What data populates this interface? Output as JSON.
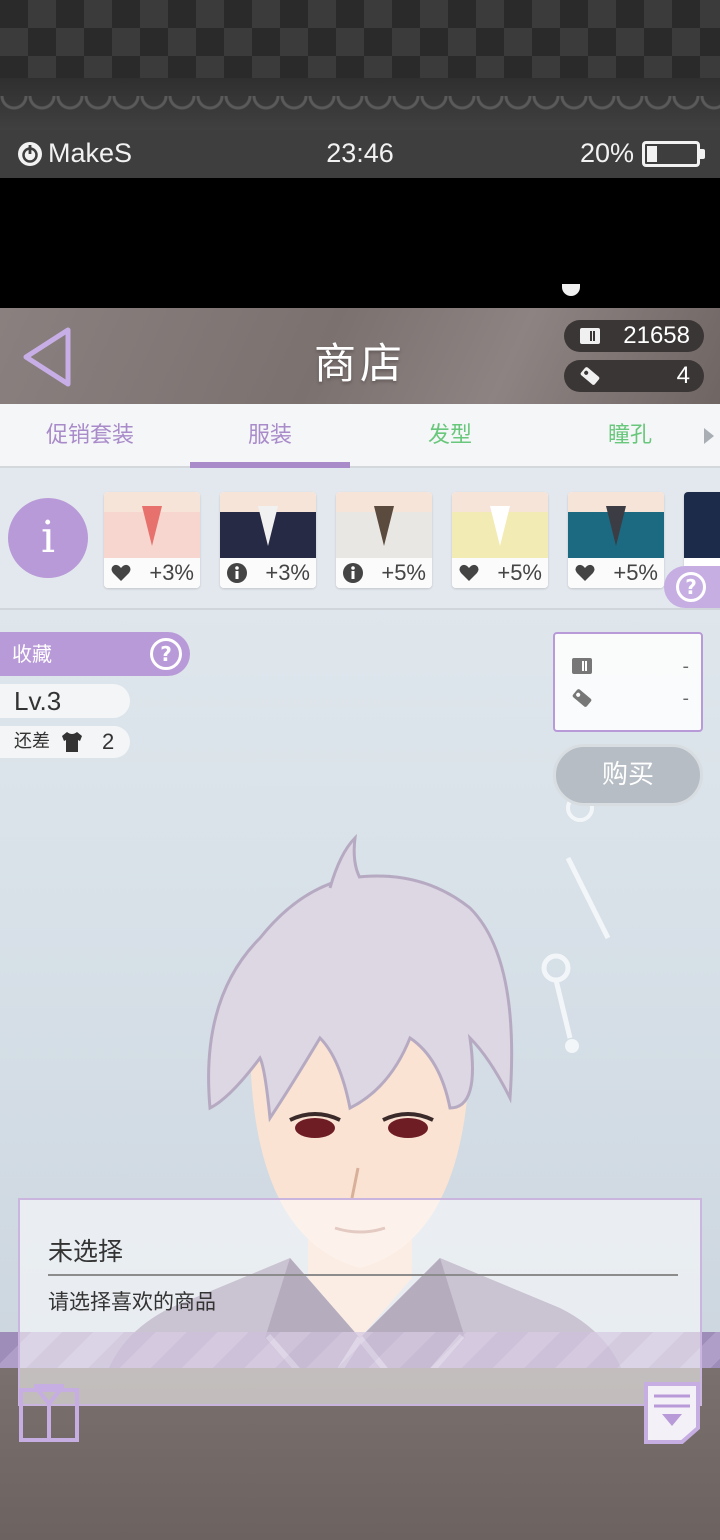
{
  "status_bar": {
    "carrier": "MakeS",
    "time": "23:46",
    "battery_text": "20%",
    "battery_level": 0.2
  },
  "header": {
    "title": "商店",
    "coins": "21658",
    "tickets": "4"
  },
  "tabs": [
    {
      "label": "促销套装",
      "active": false
    },
    {
      "label": "服装",
      "active": true
    },
    {
      "label": "发型",
      "active": false
    },
    {
      "label": "瞳孔",
      "active": false
    }
  ],
  "info_label": "i",
  "items": [
    {
      "stat_icon": "heart-icon",
      "bonus": "+3%",
      "colors": [
        "#f7d6d0",
        "#e7726d"
      ]
    },
    {
      "stat_icon": "info-icon",
      "bonus": "+3%",
      "colors": [
        "#272a45",
        "#f1f1f1"
      ]
    },
    {
      "stat_icon": "info-icon",
      "bonus": "+5%",
      "colors": [
        "#e9e7e4",
        "#5b4a3e"
      ]
    },
    {
      "stat_icon": "heart-icon",
      "bonus": "+5%",
      "colors": [
        "#f2ecb4",
        "#ffffff"
      ]
    },
    {
      "stat_icon": "heart-icon",
      "bonus": "+5%",
      "colors": [
        "#1b6a82",
        "#3c3d44"
      ]
    }
  ],
  "collection": {
    "label": "收藏",
    "level": "Lv.3",
    "remain_label": "还差",
    "remain_count": "2"
  },
  "price": {
    "coins": "-",
    "tickets": "-"
  },
  "buy_label": "购买",
  "selection": {
    "name": "未选择",
    "description": "请选择喜欢的商品"
  },
  "colors": {
    "accent_purple": "#b99ad8",
    "tab_green": "#69c77b"
  }
}
